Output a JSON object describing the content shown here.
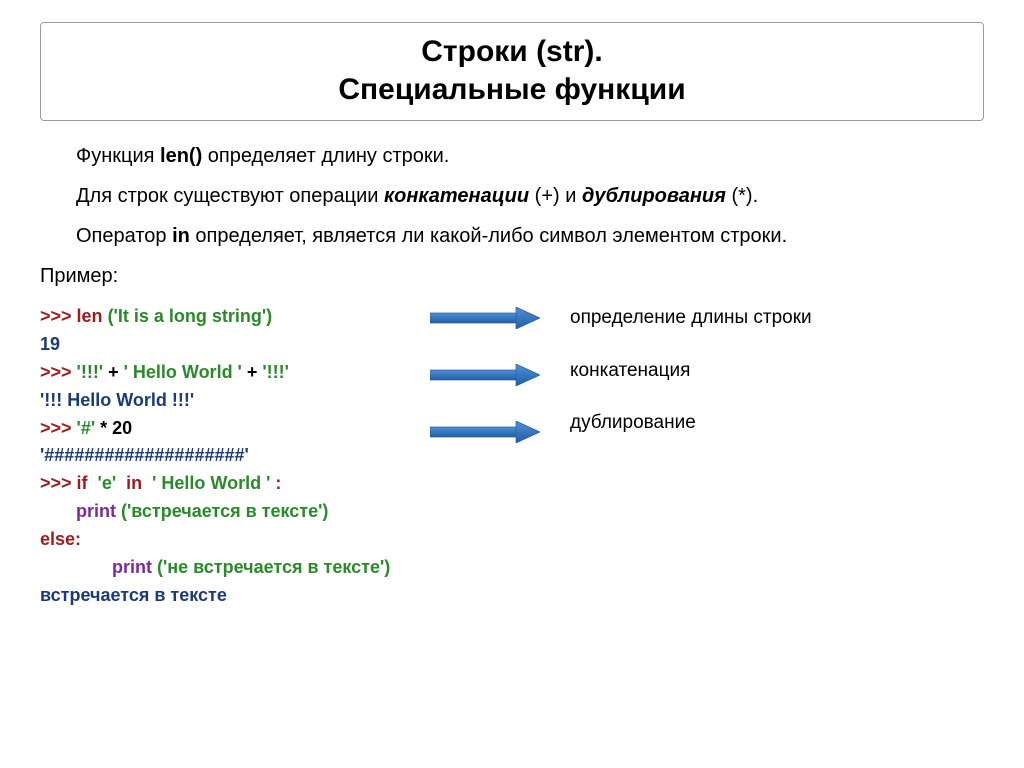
{
  "title": {
    "line1": "Строки (str).",
    "line2": "Специальные функции"
  },
  "para1": {
    "pre": "Функция ",
    "b": "len()",
    "post": " определяет длину строки."
  },
  "para2": {
    "pre": "Для строк существуют операции ",
    "b1": "конкатенации",
    "mid1": " (+) и ",
    "b2": "дублирования",
    "end": " (*)."
  },
  "para3": {
    "pre": "Оператор ",
    "b": "in",
    "post": " определяет, является ли какой-либо символ элементом строки."
  },
  "example_label": "Пример:",
  "code": {
    "l1_prompt": ">>> ",
    "l1_fn": "len ",
    "l1_args": "('It is a long string')",
    "l2": "19",
    "l3_prompt": ">>> ",
    "l3_a": "'!!!'",
    "l3_p1": " + ",
    "l3_b": "' Hello World '",
    "l3_p2": " + ",
    "l3_c": "'!!!'",
    "l4": "'!!! Hello World !!!'",
    "l5_prompt": ">>> ",
    "l5_a": "'#'",
    "l5_op": " * ",
    "l5_b": "20",
    "l6": "'####################'",
    "l7_prompt": ">>> ",
    "l7_if": "if  ",
    "l7_ch": "'e'",
    "l7_in": "  in  ",
    "l7_s": "' Hello World '",
    "l7_colon": " :",
    "l8_fn": "print ",
    "l8_arg": "('встречается в тексте')",
    "l9_else": "else",
    "l9_colon": ":",
    "l10_fn": "print ",
    "l10_arg": "('не встречается в тексте')",
    "l11": "встречается в тексте"
  },
  "desc": {
    "d1": "определение длины строки",
    "d2": "конкатенация",
    "d3": "дублирование"
  }
}
